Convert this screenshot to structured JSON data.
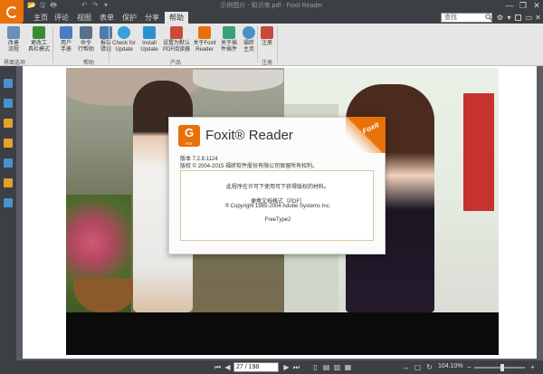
{
  "window": {
    "title": "示例图片 - 知识帝.pdf - Foxit Reader",
    "minimize": "—",
    "restore": "❐",
    "close": "✕"
  },
  "quick_access": [
    "📂",
    "🖫",
    "🖶",
    "↶",
    "↷",
    "▾"
  ],
  "menu": {
    "tabs": [
      "文件",
      "主页",
      "评论",
      "视图",
      "表单",
      "保护",
      "分享",
      "帮助"
    ],
    "active_index": 7,
    "search_placeholder": "查找"
  },
  "ribbon": {
    "buttons": [
      {
        "label": "改善\n流程",
        "color": "#6a8fb8"
      },
      {
        "label": "更改工\n具栏模式",
        "color": "#3a8a3a"
      },
      {
        "label": "用户\n手册",
        "color": "#4a7cc0"
      },
      {
        "label": "命令\n行帮助",
        "color": "#5a6f8c"
      },
      {
        "label": "报告\n错误",
        "color": "#4f7ba8"
      },
      {
        "label": "Check for\nUpdate",
        "color": "#38a0d8"
      },
      {
        "label": "Install\nUpdate",
        "color": "#2e8fd0"
      },
      {
        "label": "设置为默认\nPDF阅读器",
        "color": "#c84a3a"
      },
      {
        "label": "关于Foxit\nReader",
        "color": "#e8710a"
      },
      {
        "label": "关于插\n件插件",
        "color": "#3aa07a"
      },
      {
        "label": "福昕\n主页",
        "color": "#4a90c8"
      },
      {
        "label": "注册",
        "color": "#c84a3a"
      }
    ],
    "group_labels": [
      "界面选项",
      "帮助",
      "产品",
      "注册"
    ]
  },
  "left_panel": {
    "icons": [
      "bookmark-icon",
      "pages-icon",
      "layers-icon",
      "comments-icon",
      "attachments-icon",
      "security-icon",
      "signature-icon"
    ],
    "colors": [
      "#4a8fd0",
      "#4a8fd0",
      "#e8a02a",
      "#e8a02a",
      "#4a8fd0",
      "#e8a02a",
      "#4a8fd0"
    ]
  },
  "dialog": {
    "logo_letter": "G",
    "logo_sub": "PDF",
    "product_name": "Foxit® Reader",
    "corner_brand": "Foxit",
    "version": "版本 7.2.8.1124",
    "copyright": "版权 © 2004-2015 福昕软件股份有限公司保留所有权利。",
    "license_line": "此程序在许可下使用可下获得版权的材料。",
    "pdf_format_line": "便携文档格式（PDF）",
    "adobe_line": "® Copyright 1985-2004 Adobe Systems Inc.",
    "freetype_line": "FreeType2"
  },
  "statusbar": {
    "page_value": "27 / 198",
    "zoom": "104.10%",
    "zoom_fraction": 0.55
  },
  "colors": {
    "accent": "#e8710a",
    "chrome_dark": "#3c3f44",
    "ribbon_bg": "#e6e6e6"
  }
}
